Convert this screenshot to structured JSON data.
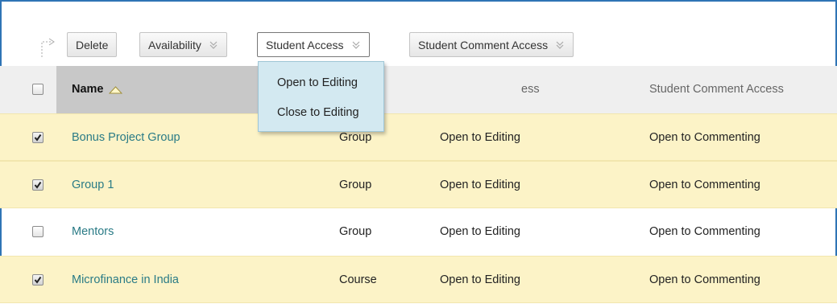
{
  "toolbar": {
    "delete_label": "Delete",
    "availability_label": "Availability",
    "student_access_label": "Student Access",
    "student_comment_access_label": "Student Comment Access"
  },
  "dropdown": {
    "items": [
      "Open to Editing",
      "Close to Editing"
    ]
  },
  "table": {
    "headers": {
      "name": "Name",
      "student_access_partial": "ess",
      "student_comment_access": "Student Comment Access"
    },
    "rows": [
      {
        "name": "Bonus Project Group",
        "type": "Group",
        "access": "Open to Editing",
        "comment": "Open to Commenting",
        "checked": true
      },
      {
        "name": "Group 1",
        "type": "Group",
        "access": "Open to Editing",
        "comment": "Open to Commenting",
        "checked": true
      },
      {
        "name": "Mentors",
        "type": "Group",
        "access": "Open to Editing",
        "comment": "Open to Commenting",
        "checked": false
      },
      {
        "name": "Microfinance in India",
        "type": "Course",
        "access": "Open to Editing",
        "comment": "Open to Commenting",
        "checked": true
      }
    ]
  },
  "colors": {
    "frame_border": "#2f74b5",
    "selected_row": "#fcf3c7",
    "header_bg": "#efefef",
    "link": "#2a7b86",
    "dropdown_bg": "#d3e9f1"
  }
}
